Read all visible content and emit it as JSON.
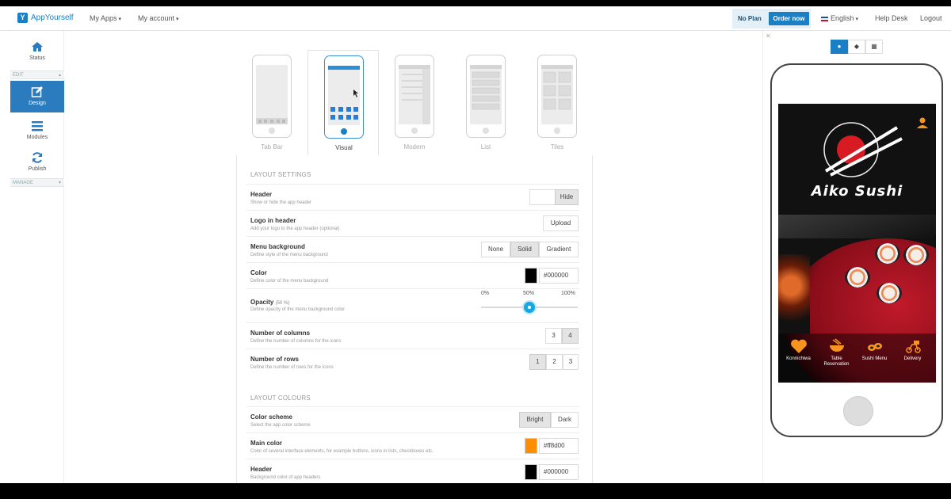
{
  "topbar": {
    "brand": "AppYourself",
    "nav": [
      "My Apps",
      "My account"
    ],
    "plan_label": "No Plan",
    "order_label": "Order now",
    "language": "English",
    "help": "Help Desk",
    "logout": "Logout"
  },
  "sidebar": {
    "items": [
      {
        "label": "Status",
        "icon": "home-icon"
      },
      {
        "label": "Design",
        "icon": "edit-icon"
      },
      {
        "label": "Modules",
        "icon": "menu-icon"
      },
      {
        "label": "Publish",
        "icon": "refresh-icon"
      }
    ],
    "sections": [
      "EDIT",
      "MANAGE"
    ]
  },
  "layouts": [
    {
      "label": "Tab Bar",
      "active": false
    },
    {
      "label": "Visual",
      "active": true
    },
    {
      "label": "Modern",
      "active": false
    },
    {
      "label": "List",
      "active": false
    },
    {
      "label": "Tiles",
      "active": false
    }
  ],
  "settings": {
    "layout_title": "LAYOUT SETTINGS",
    "colours_title": "LAYOUT COLOURS",
    "header": {
      "title": "Header",
      "desc": "Show or hide the app header",
      "button": "Hide"
    },
    "logo": {
      "title": "Logo in header",
      "desc": "Add your logo to the app header (optional)",
      "button": "Upload"
    },
    "menu_bg": {
      "title": "Menu background",
      "desc": "Define style of the menu background",
      "options": [
        "None",
        "Solid",
        "Gradient"
      ],
      "selected": "Solid"
    },
    "color": {
      "title": "Color",
      "desc": "Define color of the menu background",
      "value": "#000000",
      "swatch": "#000000"
    },
    "opacity": {
      "title": "Opacity",
      "value_label": "(50 %)",
      "desc": "Define opacity of the menu background color",
      "min": "0%",
      "mid": "50%",
      "max": "100%",
      "value": 50
    },
    "columns": {
      "title": "Number of columns",
      "desc": "Define the number of columns for the icons",
      "options": [
        "3",
        "4"
      ],
      "selected": "4"
    },
    "rows": {
      "title": "Number of rows",
      "desc": "Define the number of rows for the icons",
      "options": [
        "1",
        "2",
        "3"
      ],
      "selected": "1"
    },
    "scheme": {
      "title": "Color scheme",
      "desc": "Select the app color scheme",
      "options": [
        "Bright",
        "Dark"
      ],
      "selected": "Bright"
    },
    "main_color": {
      "title": "Main color",
      "desc": "Color of several interface elements, for example buttons, icons in lists, checkboxes etc.",
      "value": "#ff8d00",
      "swatch": "#ff8d00"
    },
    "header_color": {
      "title": "Header",
      "desc": "Background color of app headers",
      "value": "#000000",
      "swatch": "#000000"
    }
  },
  "preview": {
    "app_name": "Aiko Sushi",
    "icons": [
      {
        "label": "Konnichiwa",
        "icon": "heart-icon"
      },
      {
        "label": "Table Reservation",
        "icon": "bowl-icon"
      },
      {
        "label": "Sushi Menu",
        "icon": "sushi-icon"
      },
      {
        "label": "Delivery",
        "icon": "delivery-icon"
      }
    ],
    "accent": "#f7941d"
  }
}
